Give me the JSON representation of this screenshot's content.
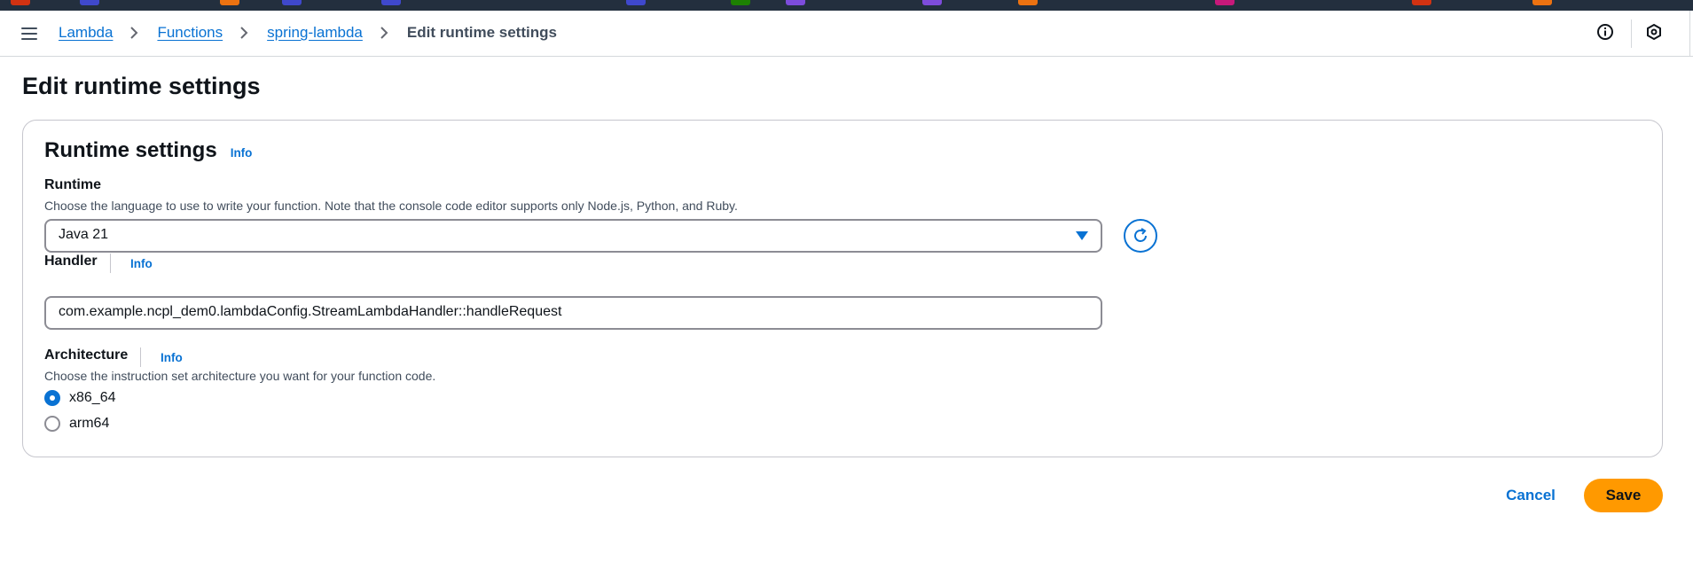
{
  "colors": {
    "accent": "#0972d3",
    "primary_button": "#ff9900",
    "top_strip": "#232f3e",
    "text": "#0f141a",
    "muted_text": "#414d5c",
    "border": "#8c8c94"
  },
  "top_strip": {
    "bookmark_colors": [
      "#d13212",
      "#3f48cc",
      "#ec7211",
      "#3f48cc",
      "#3f48cc",
      "#3f48cc",
      "#1d8102",
      "#7d4cdb",
      "#7d4cdb",
      "#ec7211",
      "#c7197a",
      "#d13212",
      "#ec7211"
    ]
  },
  "breadcrumb": {
    "items": [
      {
        "label": "Lambda"
      },
      {
        "label": "Functions"
      },
      {
        "label": "spring-lambda"
      }
    ],
    "current": "Edit runtime settings"
  },
  "utility": {
    "info_icon": "info-circle-icon",
    "settings_icon": "cloudshell-settings-icon",
    "menu_icon": "hamburger-menu-icon"
  },
  "page": {
    "title": "Edit runtime settings"
  },
  "runtime_settings": {
    "title": "Runtime settings",
    "info": "Info",
    "runtime": {
      "label": "Runtime",
      "description": "Choose the language to use to write your function. Note that the console code editor supports only Node.js, Python, and Ruby.",
      "selected": "Java 21"
    },
    "handler": {
      "label": "Handler",
      "info": "Info",
      "value": "com.example.ncpl_dem0.lambdaConfig.StreamLambdaHandler::handleRequest"
    },
    "architecture": {
      "label": "Architecture",
      "info": "Info",
      "description": "Choose the instruction set architecture you want for your function code.",
      "options": [
        {
          "label": "x86_64",
          "selected": true
        },
        {
          "label": "arm64",
          "selected": false
        }
      ]
    }
  },
  "actions": {
    "cancel": "Cancel",
    "save": "Save"
  }
}
